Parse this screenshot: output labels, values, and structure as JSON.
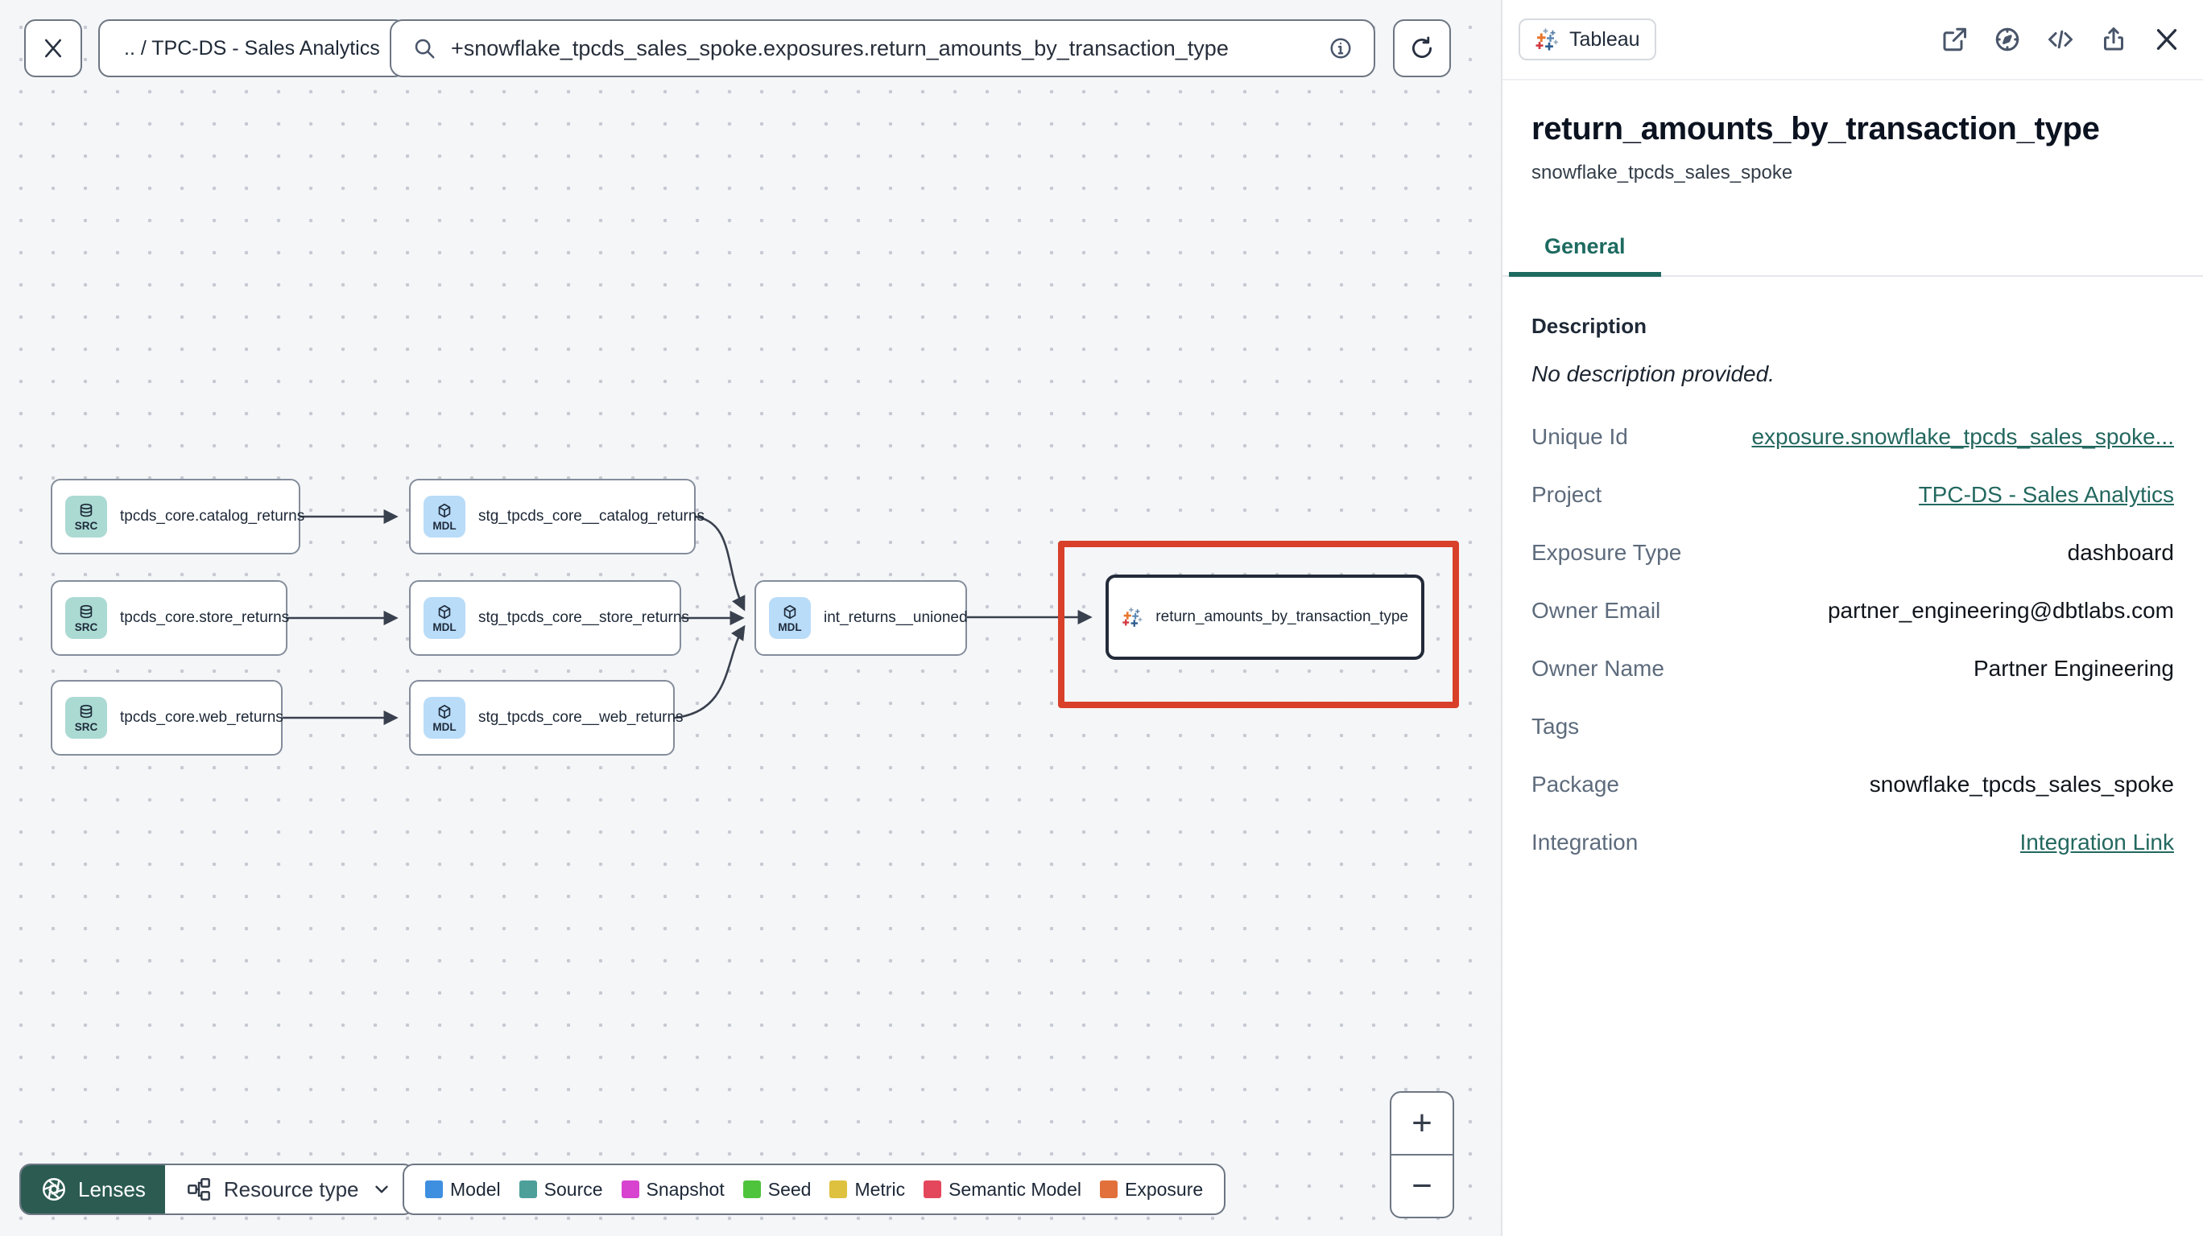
{
  "toolbar": {
    "breadcrumb": ".. / TPC-DS - Sales Analytics",
    "search_value": "+snowflake_tpcds_sales_spoke.exposures.return_amounts_by_transaction_type"
  },
  "graph": {
    "nodes": [
      {
        "label": "tpcds_core.catalog_returns",
        "badge": "SRC",
        "type": "source"
      },
      {
        "label": "tpcds_core.store_returns",
        "badge": "SRC",
        "type": "source"
      },
      {
        "label": "tpcds_core.web_returns",
        "badge": "SRC",
        "type": "source"
      },
      {
        "label": "stg_tpcds_core__catalog_returns",
        "badge": "MDL",
        "type": "model"
      },
      {
        "label": "stg_tpcds_core__store_returns",
        "badge": "MDL",
        "type": "model"
      },
      {
        "label": "stg_tpcds_core__web_returns",
        "badge": "MDL",
        "type": "model"
      },
      {
        "label": "int_returns__unioned",
        "badge": "MDL",
        "type": "model"
      },
      {
        "label": "return_amounts_by_transaction_type",
        "badge": "tableau",
        "type": "exposure",
        "selected": true
      }
    ],
    "highlight_color": "#d8402a",
    "zoom_in": "+",
    "zoom_out": "−"
  },
  "footer": {
    "lenses_label": "Lenses",
    "resource_type_label": "Resource type",
    "legend": [
      {
        "label": "Model",
        "color": "#3e8fe0"
      },
      {
        "label": "Source",
        "color": "#4da09a"
      },
      {
        "label": "Snapshot",
        "color": "#d743cf"
      },
      {
        "label": "Seed",
        "color": "#4ec43c"
      },
      {
        "label": "Metric",
        "color": "#dec13e"
      },
      {
        "label": "Semantic Model",
        "color": "#e4475c"
      },
      {
        "label": "Exposure",
        "color": "#e2703a"
      }
    ]
  },
  "panel": {
    "badge_label": "Tableau",
    "title": "return_amounts_by_transaction_type",
    "subtitle": "snowflake_tpcds_sales_spoke",
    "tab_general": "General",
    "description_heading": "Description",
    "description_empty": "No description provided.",
    "accent_color": "#1d6a60",
    "fields": [
      {
        "label": "Unique Id",
        "value": "exposure.snowflake_tpcds_sales_spoke...",
        "link": true
      },
      {
        "label": "Project",
        "value": "TPC-DS - Sales Analytics",
        "link": true
      },
      {
        "label": "Exposure Type",
        "value": "dashboard",
        "link": false
      },
      {
        "label": "Owner Email",
        "value": "partner_engineering@dbtlabs.com",
        "link": false
      },
      {
        "label": "Owner Name",
        "value": "Partner Engineering",
        "link": false
      },
      {
        "label": "Tags",
        "value": "",
        "link": false
      },
      {
        "label": "Package",
        "value": "snowflake_tpcds_sales_spoke",
        "link": false
      },
      {
        "label": "Integration",
        "value": "Integration Link",
        "link": true
      }
    ]
  }
}
